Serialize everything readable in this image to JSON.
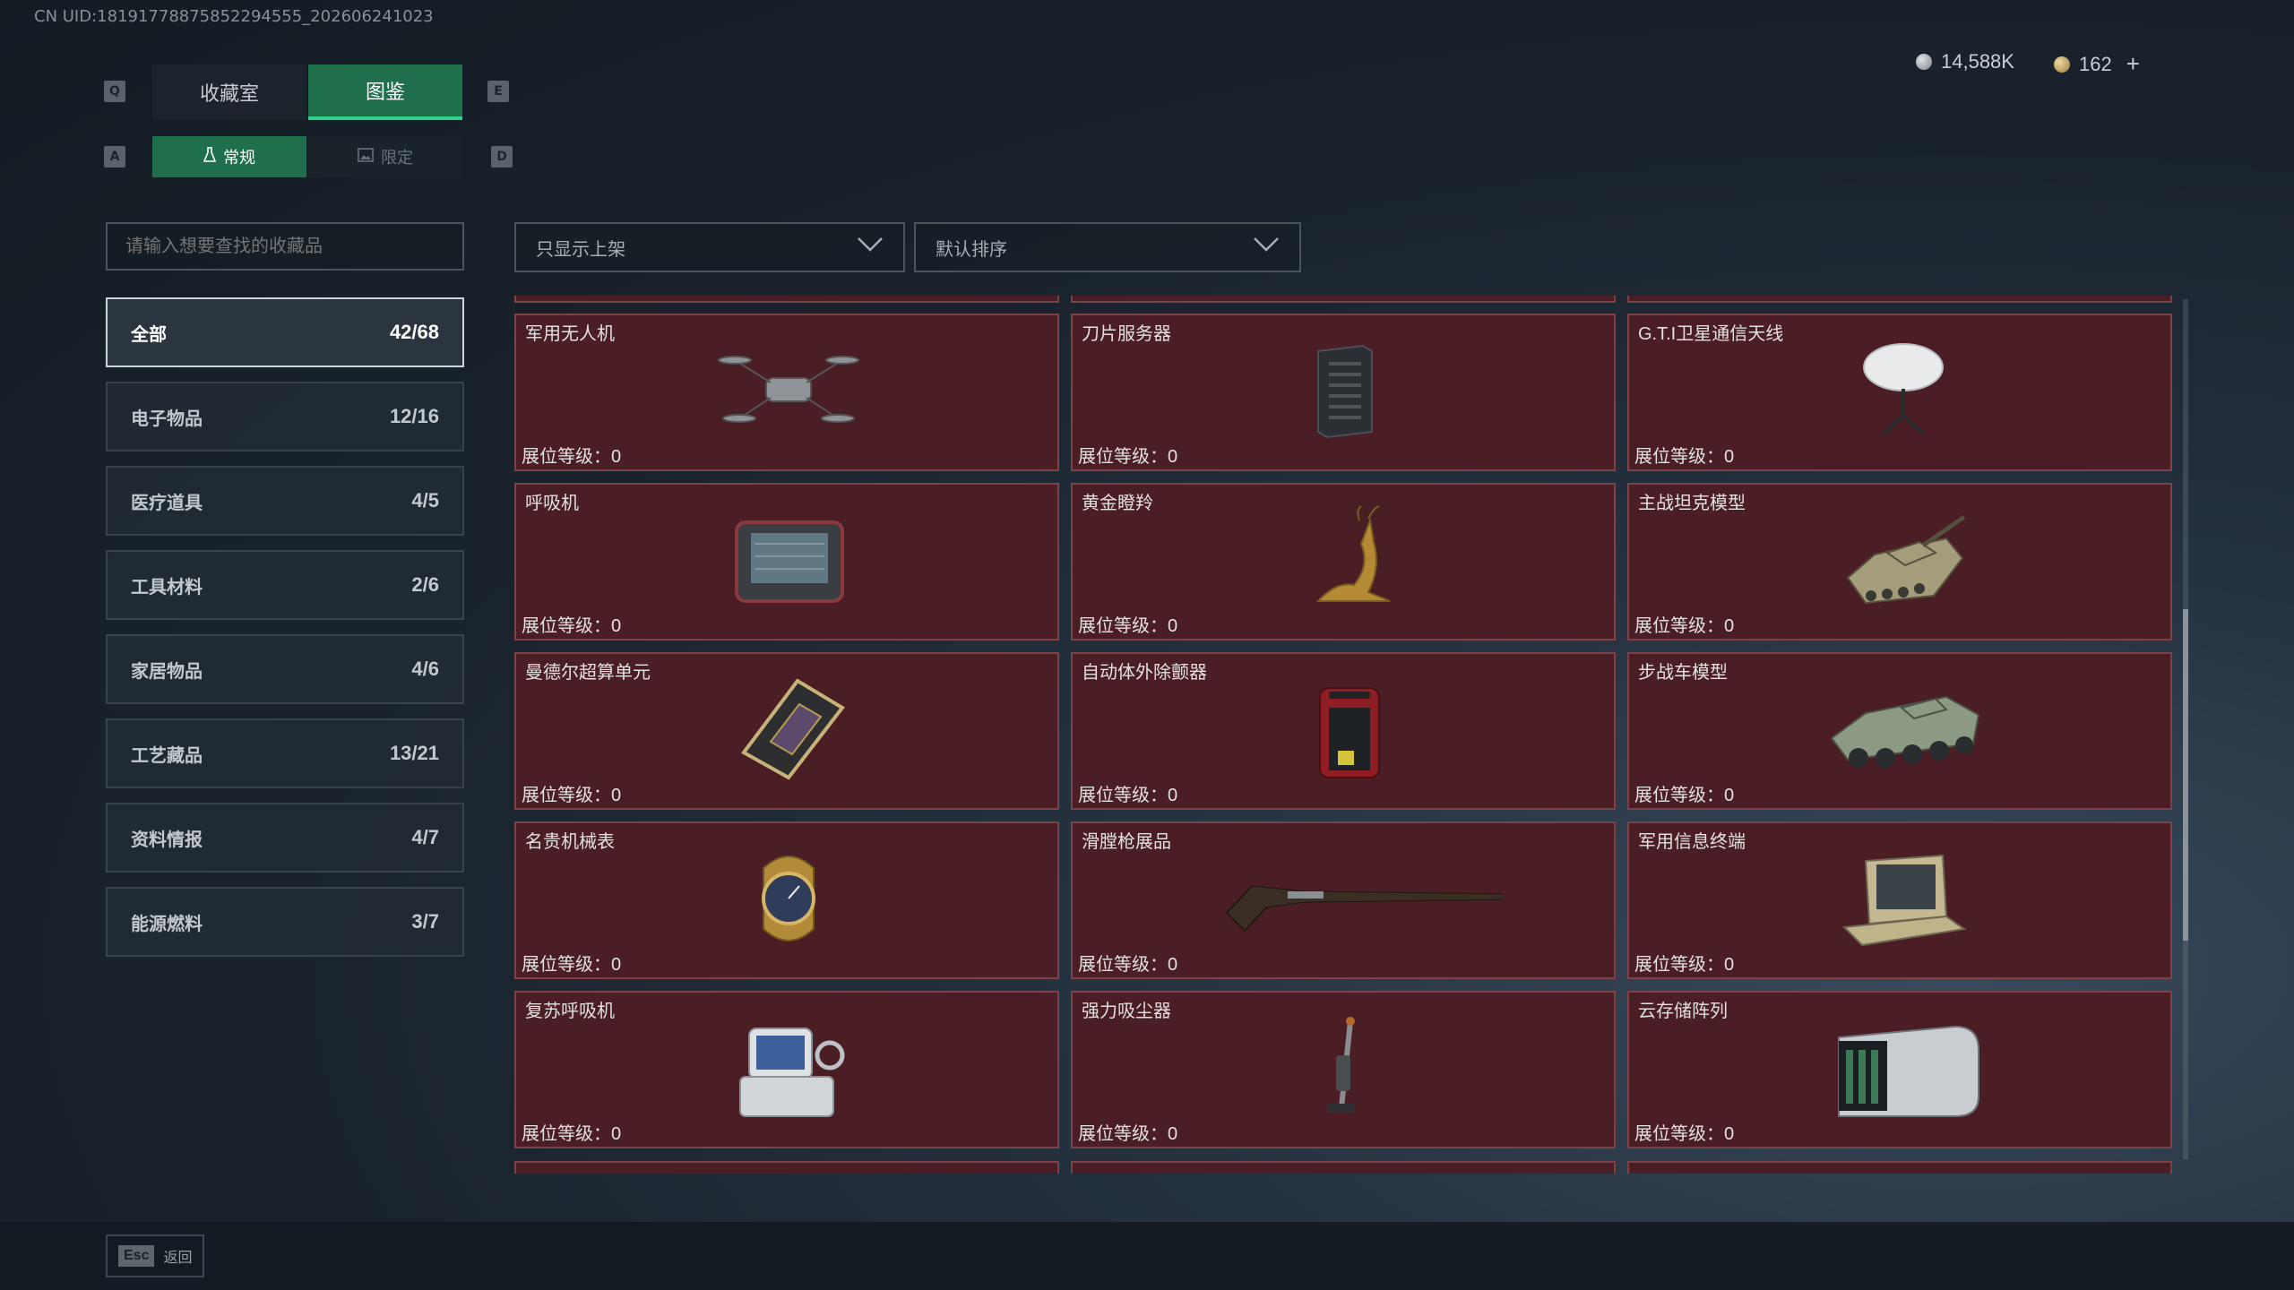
{
  "uid": "CN UID:18191778875852294555_202606241023",
  "keys": {
    "left_tab": "Q",
    "right_tab": "E",
    "left_sub": "A",
    "right_sub": "D"
  },
  "tabs": [
    {
      "label": "收藏室",
      "active": false
    },
    {
      "label": "图鉴",
      "active": true
    }
  ],
  "subtabs": [
    {
      "label": "常规",
      "active": true
    },
    {
      "label": "限定",
      "active": false
    }
  ],
  "currency": {
    "silver": "14,588K",
    "gold": "162",
    "add": "+"
  },
  "search": {
    "placeholder": "请输入想要查找的收藏品"
  },
  "filters": {
    "display": "只显示上架",
    "sort": "默认排序"
  },
  "categories": [
    {
      "label": "全部",
      "count": "42/68",
      "active": true
    },
    {
      "label": "电子物品",
      "count": "12/16"
    },
    {
      "label": "医疗道具",
      "count": "4/5"
    },
    {
      "label": "工具材料",
      "count": "2/6"
    },
    {
      "label": "家居物品",
      "count": "4/6"
    },
    {
      "label": "工艺藏品",
      "count": "13/21"
    },
    {
      "label": "资料情报",
      "count": "4/7"
    },
    {
      "label": "能源燃料",
      "count": "3/7"
    }
  ],
  "level_label": "展位等级：0",
  "items": [
    {
      "name": "军用无人机",
      "icon": "drone-icon"
    },
    {
      "name": "刀片服务器",
      "icon": "server-icon"
    },
    {
      "name": "G.T.I卫星通信天线",
      "icon": "satellite-dish-icon"
    },
    {
      "name": "呼吸机",
      "icon": "ventilator-icon"
    },
    {
      "name": "黄金瞪羚",
      "icon": "gazelle-statue-icon"
    },
    {
      "name": "主战坦克模型",
      "icon": "tank-icon"
    },
    {
      "name": "曼德尔超算单元",
      "icon": "gpu-icon"
    },
    {
      "name": "自动体外除颤器",
      "icon": "defibrillator-icon"
    },
    {
      "name": "步战车模型",
      "icon": "ifv-icon"
    },
    {
      "name": "名贵机械表",
      "icon": "watch-icon"
    },
    {
      "name": "滑膛枪展品",
      "icon": "musket-icon"
    },
    {
      "name": "军用信息终端",
      "icon": "terminal-case-icon"
    },
    {
      "name": "复苏呼吸机",
      "icon": "resuscitator-icon"
    },
    {
      "name": "强力吸尘器",
      "icon": "vacuum-icon"
    },
    {
      "name": "云存储阵列",
      "icon": "storage-array-icon"
    }
  ],
  "footer": {
    "esc_key": "Esc",
    "esc_label": "返回"
  }
}
